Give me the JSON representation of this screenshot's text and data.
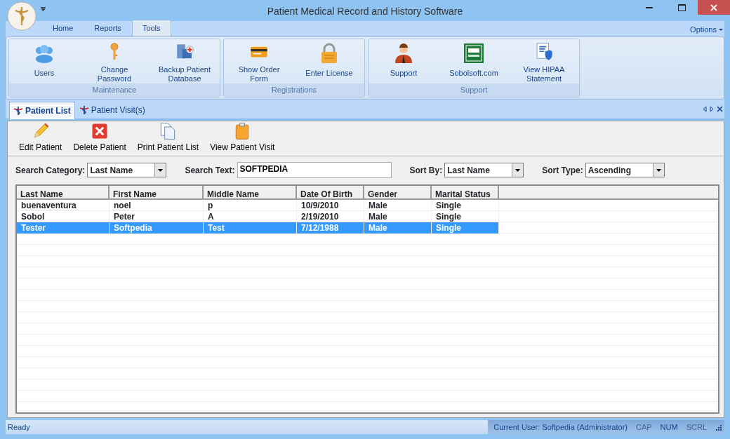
{
  "window": {
    "title": "Patient Medical Record and History Software"
  },
  "ribbon_tabs": [
    {
      "label": "Home",
      "selected": false
    },
    {
      "label": "Reports",
      "selected": false
    },
    {
      "label": "Tools",
      "selected": true
    }
  ],
  "options_menu": "Options",
  "ribbon_groups": [
    {
      "label": "Maintenance",
      "buttons": [
        {
          "label": "Users",
          "kind": "users"
        },
        {
          "label": "Change Password",
          "kind": "key"
        },
        {
          "label": "Backup Patient Database",
          "kind": "building"
        }
      ]
    },
    {
      "label": "Registrations",
      "buttons": [
        {
          "label": "Show Order Form",
          "kind": "card"
        },
        {
          "label": "Enter License",
          "kind": "lock"
        }
      ]
    },
    {
      "label": "Support",
      "buttons": [
        {
          "label": "Support",
          "kind": "agent"
        },
        {
          "label": "Sobolsoft.com",
          "kind": "logo"
        },
        {
          "label": "View HIPAA Statement",
          "kind": "shield"
        }
      ]
    }
  ],
  "doc_tabs": [
    {
      "label": "Patient List",
      "selected": true
    },
    {
      "label": "Patient Visit(s)",
      "selected": false
    }
  ],
  "toolbar": [
    {
      "label": "Edit Patient",
      "kind": "pencil"
    },
    {
      "label": "Delete Patient",
      "kind": "delete"
    },
    {
      "label": "Print Patient List",
      "kind": "pages"
    },
    {
      "label": "View Patient Visit",
      "kind": "clipboard"
    }
  ],
  "filters": [
    {
      "label": "Search Category:",
      "kind": "dropdown",
      "value": "Last Name"
    },
    {
      "label": "Search Text:",
      "kind": "text",
      "value": "SOFTPEDIA"
    },
    {
      "label": "Sort By:",
      "kind": "dropdown",
      "value": "Last Name"
    },
    {
      "label": "Sort Type:",
      "kind": "dropdown",
      "value": "Ascending"
    }
  ],
  "table": {
    "columns": [
      "Last Name",
      "First Name",
      "Middle Name",
      "Date Of Birth",
      "Gender",
      "Marital Status"
    ],
    "rows": [
      {
        "cells": [
          "buenaventura",
          "noel",
          "p",
          "10/9/2010",
          "Male",
          "Single"
        ],
        "selected": false
      },
      {
        "cells": [
          "Sobol",
          "Peter",
          "A",
          "2/19/2010",
          "Male",
          "Single"
        ],
        "selected": false
      },
      {
        "cells": [
          "Tester",
          "Softpedia",
          "Test",
          "7/12/1988",
          "Male",
          "Single"
        ],
        "selected": true
      }
    ]
  },
  "status_bar": {
    "message": "Ready",
    "user": "Current User: Softpedia (Administrator)",
    "indicators": [
      {
        "label": "CAP",
        "on": false
      },
      {
        "label": "NUM",
        "on": true
      },
      {
        "label": "SCRL",
        "on": false
      }
    ]
  }
}
